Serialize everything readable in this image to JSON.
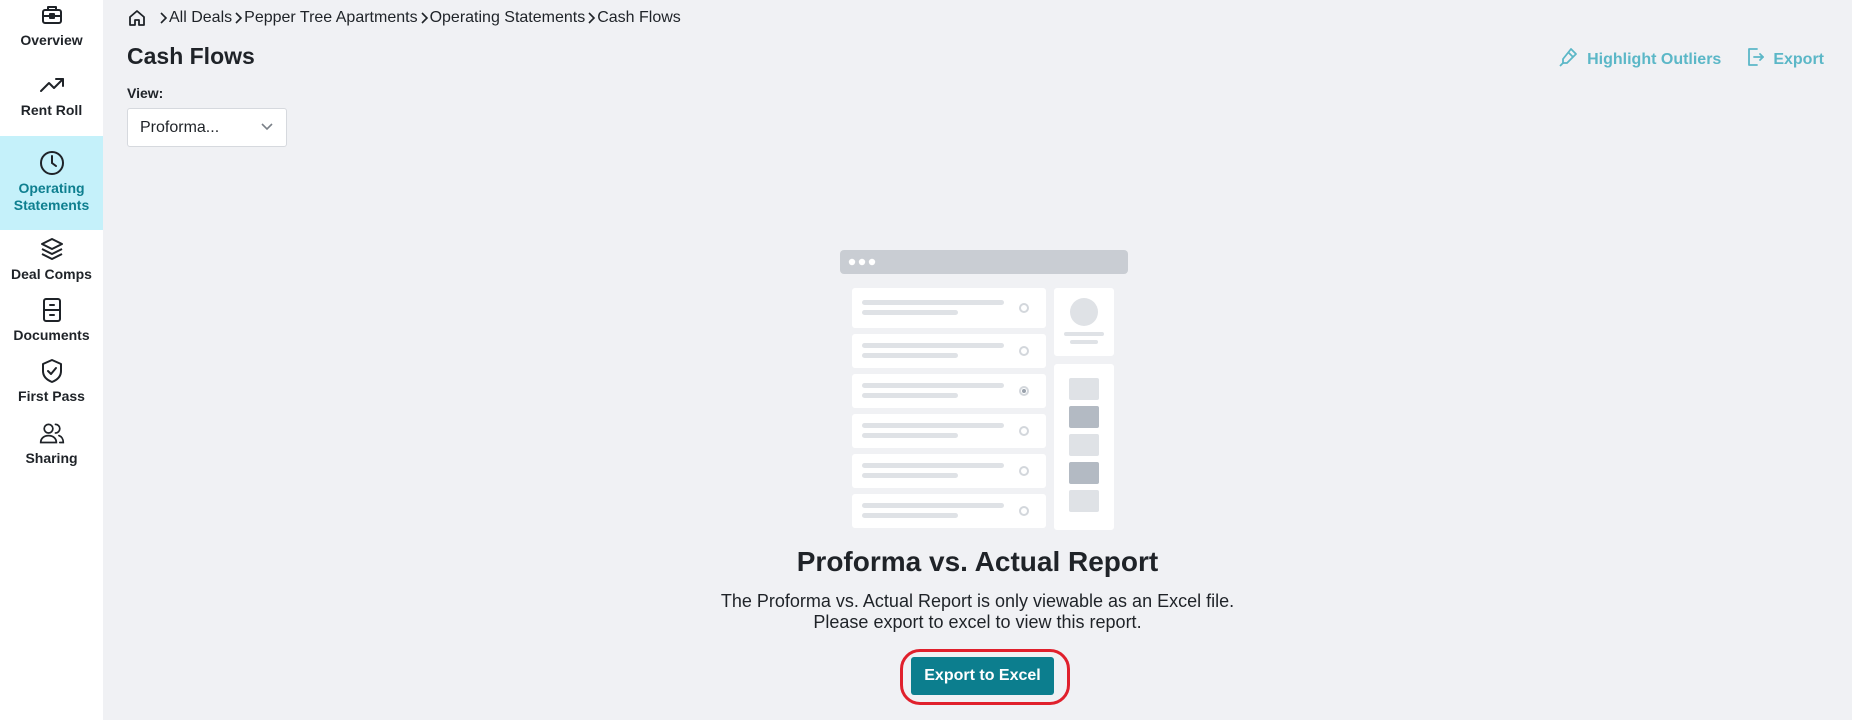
{
  "sidebar": {
    "items": [
      {
        "label": "Overview",
        "icon": "briefcase-icon"
      },
      {
        "label": "Rent Roll",
        "icon": "trend-up-icon"
      },
      {
        "label": "Operating Statements",
        "icon": "clock-icon",
        "active": true
      },
      {
        "label": "Deal Comps",
        "icon": "layers-icon"
      },
      {
        "label": "Documents",
        "icon": "archive-icon"
      },
      {
        "label": "First Pass",
        "icon": "shield-check-icon"
      },
      {
        "label": "Sharing",
        "icon": "users-icon"
      }
    ]
  },
  "breadcrumb": {
    "home_icon": "home-icon",
    "items": [
      "All Deals",
      "Pepper Tree Apartments",
      "Operating Statements",
      "Cash Flows"
    ]
  },
  "header": {
    "title": "Cash Flows",
    "highlight_outliers_label": "Highlight Outliers",
    "export_label": "Export"
  },
  "view": {
    "label": "View:",
    "selected": "Proforma..."
  },
  "report": {
    "title": "Proforma vs. Actual Report",
    "description_line1": "The Proforma vs. Actual Report is only viewable as an Excel file.",
    "description_line2": "Please export to excel to view this report.",
    "export_button_label": "Export to Excel"
  },
  "colors": {
    "accent": "#0c7e8e",
    "active_nav_bg": "#c5f1fa",
    "link": "#5bb7c7",
    "highlight": "#e0202c"
  }
}
